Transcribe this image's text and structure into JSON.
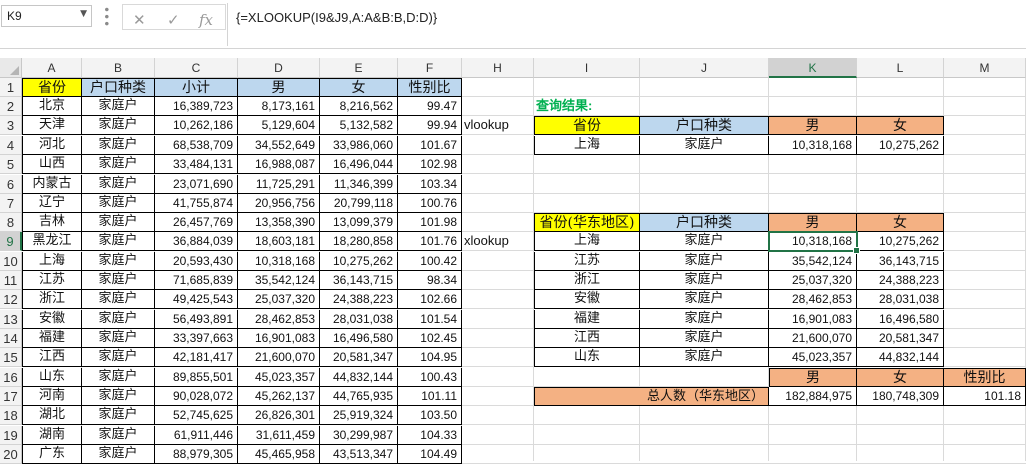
{
  "formula_bar": {
    "name_box": "K9",
    "formula": "{=XLOOKUP(I9&J9,A:A&B:B,D:D)}",
    "icons": [
      "cancel-icon",
      "confirm-icon",
      "function-icon"
    ]
  },
  "sheet": {
    "columns": [
      "A",
      "B",
      "C",
      "D",
      "E",
      "F",
      "H",
      "I",
      "J",
      "K",
      "L",
      "M"
    ],
    "selected_column": "K",
    "rows": [
      "1",
      "2",
      "3",
      "4",
      "5",
      "6",
      "7",
      "8",
      "9",
      "10",
      "11",
      "12",
      "13",
      "14",
      "15",
      "16",
      "17",
      "18",
      "19",
      "20"
    ],
    "selected_row": "9",
    "main_table": {
      "headers": [
        "省份",
        "户口种类",
        "小计",
        "男",
        "女",
        "性别比"
      ],
      "rows": [
        [
          "北京",
          "家庭户",
          "16,389,723",
          "8,173,161",
          "8,216,562",
          "99.47"
        ],
        [
          "天津",
          "家庭户",
          "10,262,186",
          "5,129,604",
          "5,132,582",
          "99.94"
        ],
        [
          "河北",
          "家庭户",
          "68,538,709",
          "34,552,649",
          "33,986,060",
          "101.67"
        ],
        [
          "山西",
          "家庭户",
          "33,484,131",
          "16,988,087",
          "16,496,044",
          "102.98"
        ],
        [
          "内蒙古",
          "家庭户",
          "23,071,690",
          "11,725,291",
          "11,346,399",
          "103.34"
        ],
        [
          "辽宁",
          "家庭户",
          "41,755,874",
          "20,956,756",
          "20,799,118",
          "100.76"
        ],
        [
          "吉林",
          "家庭户",
          "26,457,769",
          "13,358,390",
          "13,099,379",
          "101.98"
        ],
        [
          "黑龙江",
          "家庭户",
          "36,884,039",
          "18,603,181",
          "18,280,858",
          "101.76"
        ],
        [
          "上海",
          "家庭户",
          "20,593,430",
          "10,318,168",
          "10,275,262",
          "100.42"
        ],
        [
          "江苏",
          "家庭户",
          "71,685,839",
          "35,542,124",
          "36,143,715",
          "98.34"
        ],
        [
          "浙江",
          "家庭户",
          "49,425,543",
          "25,037,320",
          "24,388,223",
          "102.66"
        ],
        [
          "安徽",
          "家庭户",
          "56,493,891",
          "28,462,853",
          "28,031,038",
          "101.54"
        ],
        [
          "福建",
          "家庭户",
          "33,397,663",
          "16,901,083",
          "16,496,580",
          "102.45"
        ],
        [
          "江西",
          "家庭户",
          "42,181,417",
          "21,600,070",
          "20,581,347",
          "104.95"
        ],
        [
          "山东",
          "家庭户",
          "89,855,501",
          "45,023,357",
          "44,832,144",
          "100.43"
        ],
        [
          "河南",
          "家庭户",
          "90,028,072",
          "45,262,137",
          "44,765,935",
          "101.11"
        ],
        [
          "湖北",
          "家庭户",
          "52,745,625",
          "26,826,301",
          "25,919,324",
          "103.50"
        ],
        [
          "湖南",
          "家庭户",
          "61,911,446",
          "31,611,459",
          "30,299,987",
          "104.33"
        ],
        [
          "广东",
          "家庭户",
          "88,979,305",
          "45,465,958",
          "43,513,347",
          "104.49"
        ]
      ]
    },
    "query_title": "查询结果:",
    "vlookup_label": "vlookup",
    "xlookup_label": "xlookup",
    "vlookup_table": {
      "headers": [
        "省份",
        "户口种类",
        "男",
        "女"
      ],
      "row": [
        "上海",
        "家庭户",
        "10,318,168",
        "10,275,262"
      ]
    },
    "xlookup_table": {
      "headers": [
        "省份(华东地区)",
        "户口种类",
        "男",
        "女"
      ],
      "rows": [
        [
          "上海",
          "家庭户",
          "10,318,168",
          "10,275,262"
        ],
        [
          "江苏",
          "家庭户",
          "35,542,124",
          "36,143,715"
        ],
        [
          "浙江",
          "家庭户",
          "25,037,320",
          "24,388,223"
        ],
        [
          "安徽",
          "家庭户",
          "28,462,853",
          "28,031,038"
        ],
        [
          "福建",
          "家庭户",
          "16,901,083",
          "16,496,580"
        ],
        [
          "江西",
          "家庭户",
          "21,600,070",
          "20,581,347"
        ],
        [
          "山东",
          "家庭户",
          "45,023,357",
          "44,832,144"
        ]
      ]
    },
    "total_table": {
      "headers": [
        "男",
        "女",
        "性别比"
      ],
      "label": "总人数（华东地区）",
      "values": [
        "182,884,975",
        "180,748,309",
        "101.18"
      ]
    }
  },
  "colors": {
    "yellow_header": "#ffff00",
    "blue_header": "#bdd7ee",
    "orange_header": "#f4b183",
    "query_title_green": "#00b050",
    "selection_green": "#217346"
  }
}
